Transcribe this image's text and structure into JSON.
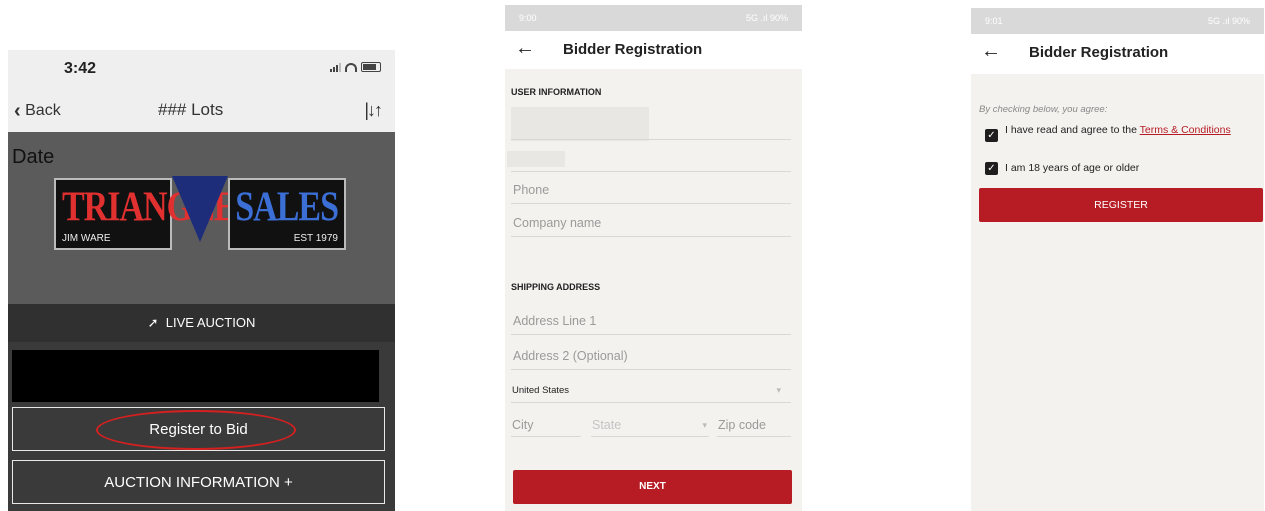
{
  "phone1": {
    "status_time": "3:42",
    "back_label": "Back",
    "nav_title": "### Lots",
    "date_label": "Date",
    "logo": {
      "left_word": "TRIANGLE",
      "right_word": "SALES",
      "left_sub": "JIM WARE",
      "right_sub": "EST 1979"
    },
    "live_auction_label": "LIVE AUCTION",
    "register_button": "Register to Bid",
    "auction_info_button": "AUCTION INFORMATION +"
  },
  "phone2": {
    "status_time": "9:00",
    "status_right": "5G .ıl 90%",
    "title": "Bidder Registration",
    "user_info_header": "USER INFORMATION",
    "phone_placeholder": "Phone",
    "company_placeholder": "Company name",
    "shipping_header": "SHIPPING ADDRESS",
    "address1_placeholder": "Address Line 1",
    "address2_placeholder": "Address 2 (Optional)",
    "country_value": "United States",
    "city_placeholder": "City",
    "state_placeholder": "State",
    "zip_placeholder": "Zip code",
    "next_button": "NEXT"
  },
  "phone3": {
    "status_time": "9:01",
    "status_right": "5G .ıl 90%",
    "title": "Bidder Registration",
    "agree_label": "By checking below, you agree:",
    "terms_prefix": "I have read and agree to the ",
    "terms_link": "Terms & Conditions",
    "age_label": "I am 18 years of age or older",
    "register_button": "REGISTER"
  },
  "colors": {
    "accent_red": "#b71c24",
    "annotation_red": "#d62020",
    "dark_panel": "#3a3a3a"
  },
  "icons": [
    "signal-icon",
    "wifi-icon",
    "battery-icon",
    "chevron-left-icon",
    "sliders-icon",
    "gavel-icon",
    "back-arrow-icon",
    "checkbox-checked-icon",
    "dropdown-arrow-icon"
  ]
}
